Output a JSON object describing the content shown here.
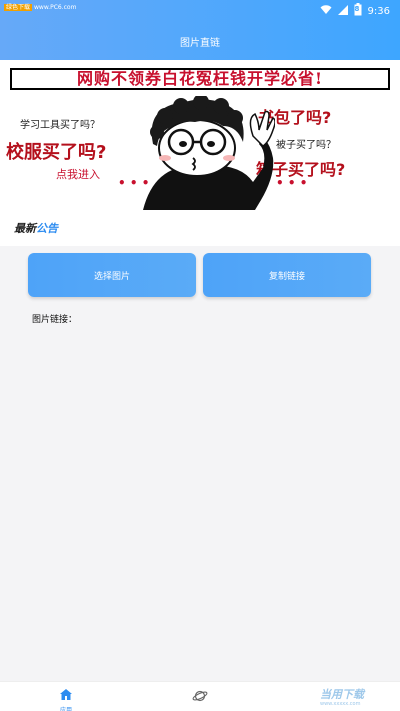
{
  "status_bar": {
    "watermark_tag": "绿色下载",
    "watermark_url": "www.PC6.com",
    "battery_level": "8",
    "time": "9:36"
  },
  "app": {
    "title": "图片直链"
  },
  "banner": {
    "headline": "网购不领券白花冤枉钱开学必省!",
    "captions": {
      "study_tools": "学习工具买了吗？",
      "uniform": "校服买了吗?",
      "click_enter": "点我进入",
      "schoolbag": "书包了吗?",
      "quilt": "被子买了吗？",
      "suitcase": "箱子买了吗?",
      "dots_left": "• • •",
      "dots_right": "• • •"
    }
  },
  "notice": {
    "badge_part1": "最新",
    "badge_part2": "公告"
  },
  "actions": {
    "select_image": "选择图片",
    "copy_link": "复制链接"
  },
  "link": {
    "label": "图片链接："
  },
  "bottom_nav": {
    "home_label": "应用",
    "watermark": "当用下载",
    "watermark_sub": "www.xxxxx.com"
  },
  "colors": {
    "accent": "#3ea6ff",
    "headline_red": "#c8102e",
    "button": "#5aabf7"
  }
}
